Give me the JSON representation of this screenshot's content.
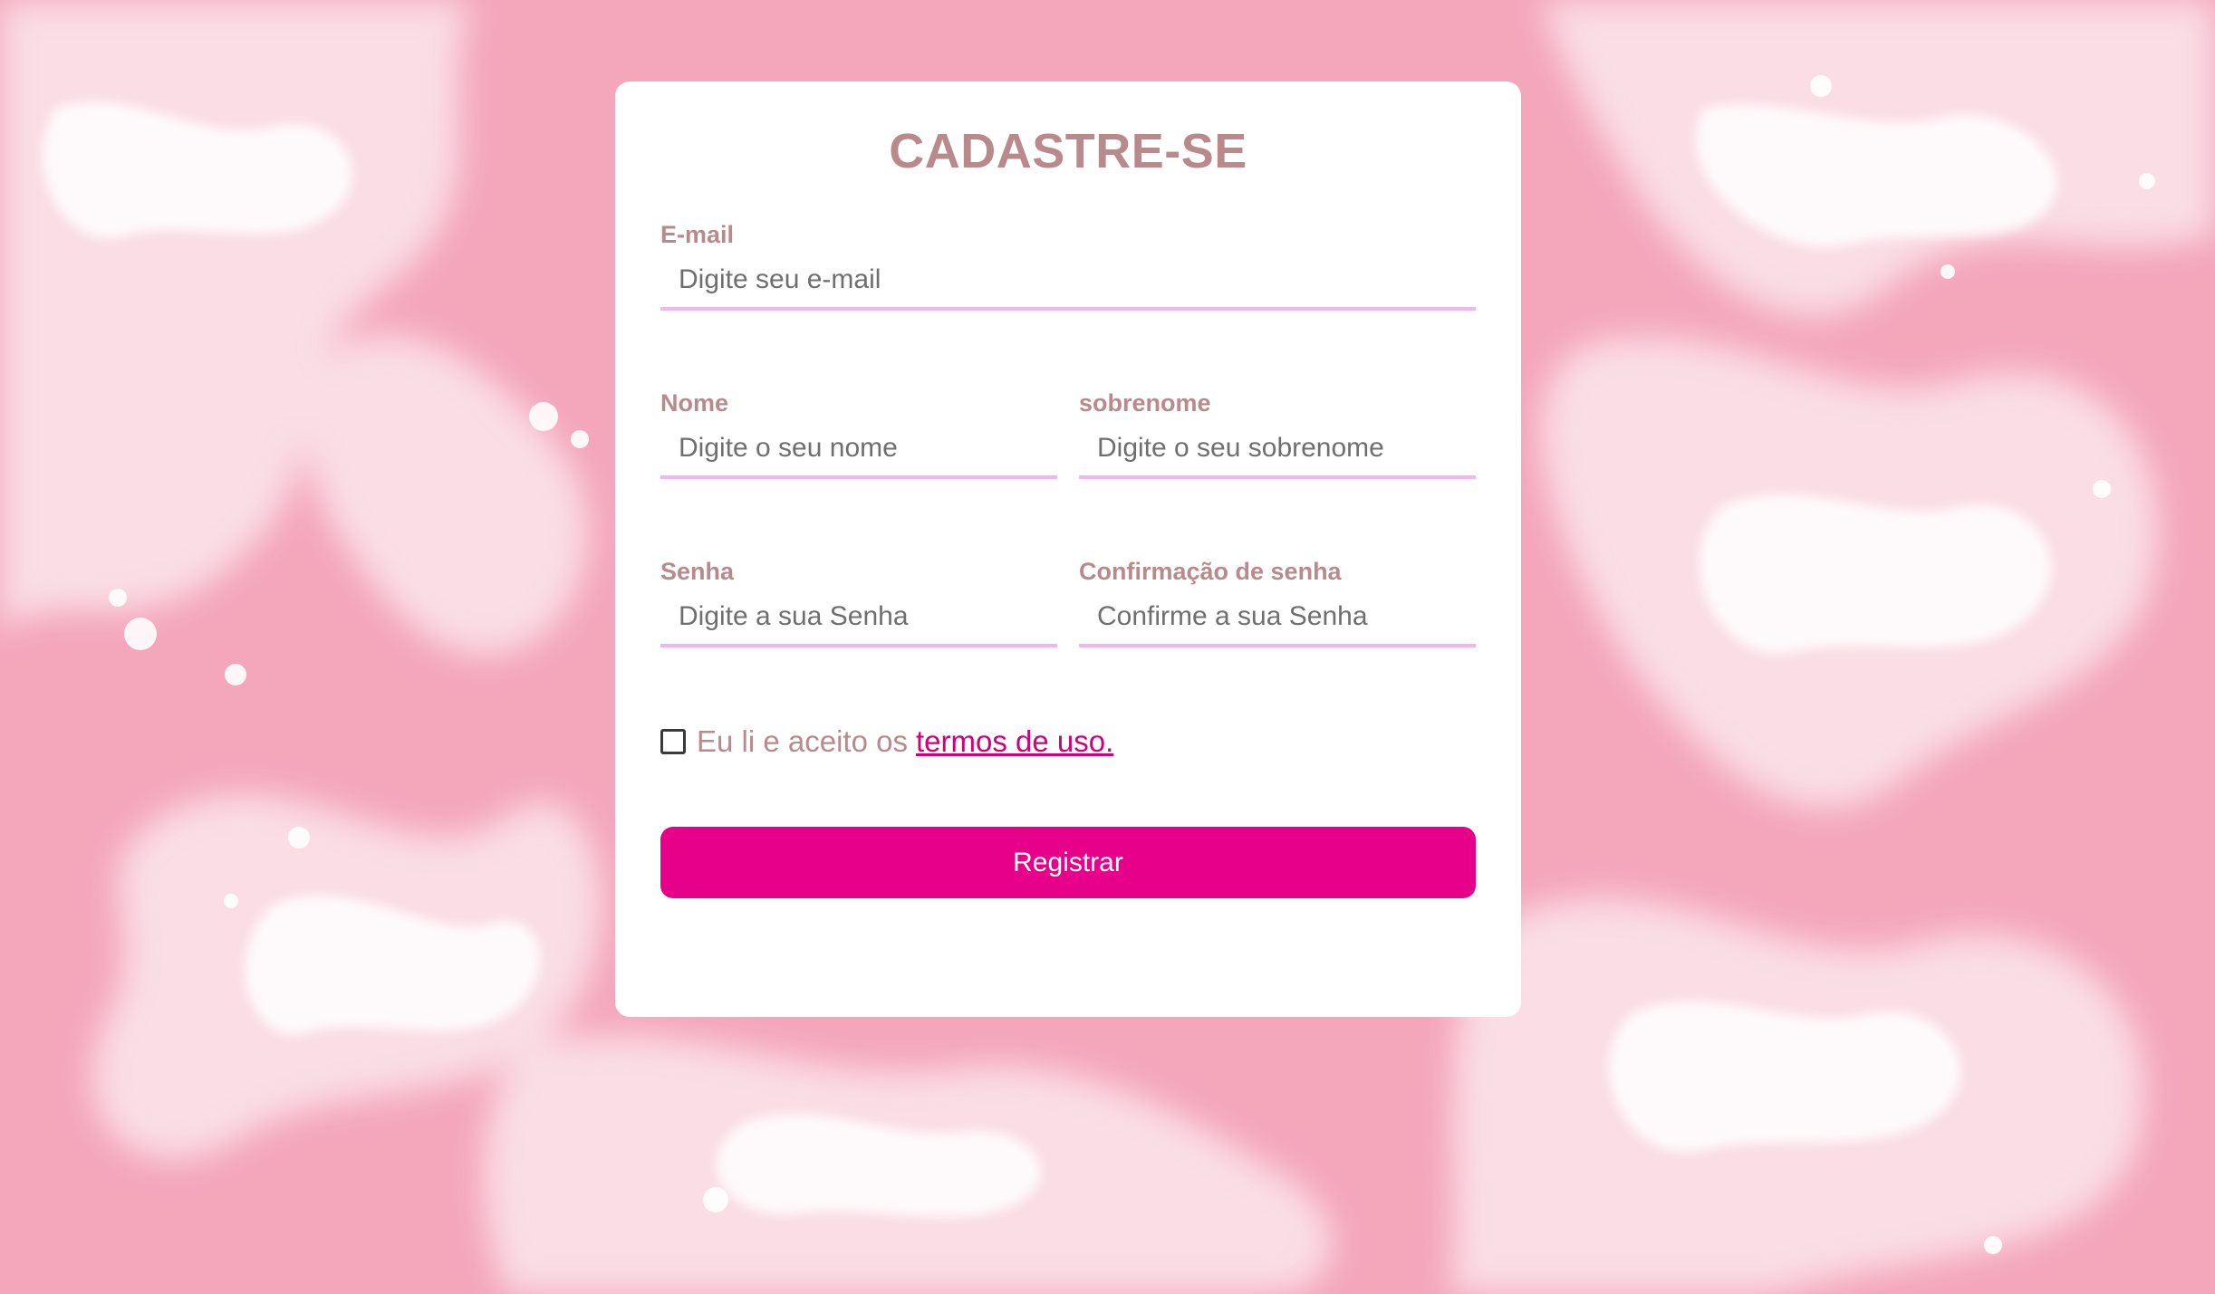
{
  "colors": {
    "background": "#f4a6bb",
    "card": "#ffffff",
    "accent": "#e6008a",
    "label": "#b98a8c",
    "underline": "#f6b3f2",
    "link": "#d1007a"
  },
  "form": {
    "title": "CADASTRE-SE",
    "email": {
      "label": "E-mail",
      "placeholder": "Digite seu e-mail",
      "value": ""
    },
    "first_name": {
      "label": "Nome",
      "placeholder": "Digite o seu nome",
      "value": ""
    },
    "last_name": {
      "label": "sobrenome",
      "placeholder": "Digite o seu sobrenome",
      "value": ""
    },
    "password": {
      "label": "Senha",
      "placeholder": "Digite a sua Senha",
      "value": ""
    },
    "password_confirm": {
      "label": "Confirmação de senha",
      "placeholder": "Confirme a sua Senha",
      "value": ""
    },
    "terms": {
      "checked": false,
      "text": "Eu li e aceito os",
      "link_text": "termos de uso."
    },
    "submit_label": "Registrar"
  }
}
